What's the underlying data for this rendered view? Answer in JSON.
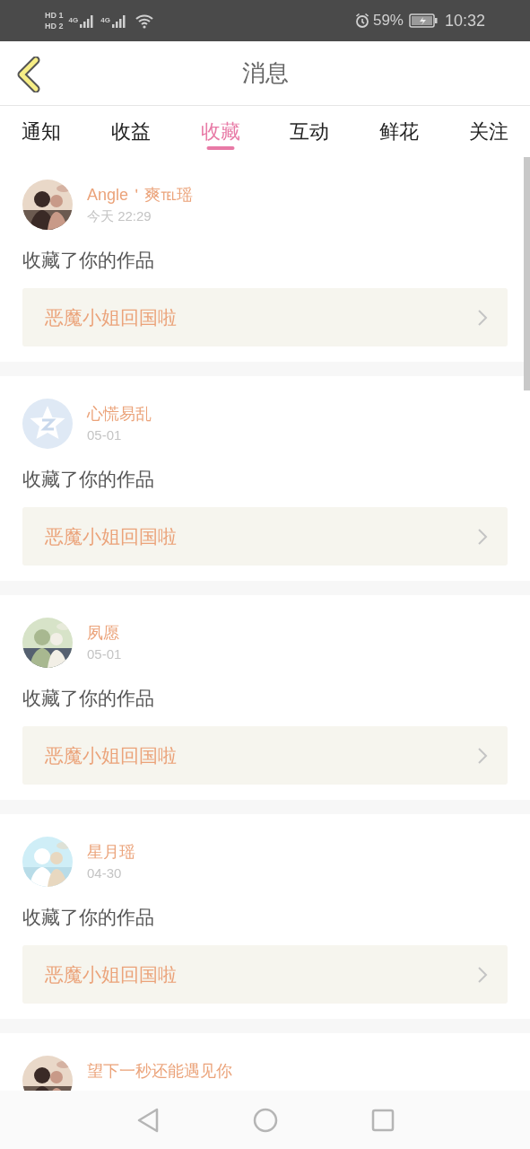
{
  "status_bar": {
    "sims": [
      {
        "hd": "HD",
        "slot": "1",
        "network": "4G"
      },
      {
        "hd": "HD",
        "slot": "2",
        "network": "4G"
      }
    ],
    "battery": "59%",
    "time": "10:32"
  },
  "header": {
    "title": "消息"
  },
  "tabs": [
    {
      "label": "通知",
      "selected": false
    },
    {
      "label": "收益",
      "selected": false
    },
    {
      "label": "收藏",
      "selected": true
    },
    {
      "label": "互动",
      "selected": false
    },
    {
      "label": "鲜花",
      "selected": false
    },
    {
      "label": "关注",
      "selected": false
    }
  ],
  "messages": [
    {
      "name": "Angle＇爽℡瑶",
      "time": "今天 22:29",
      "text": "收藏了你的作品",
      "work": "恶魔小姐回国啦"
    },
    {
      "avatar": {
        "kind": "default"
      },
      "name": "心慌易乱",
      "time": "05-01",
      "text": "收藏了你的作品",
      "work": "恶魔小姐回国啦"
    },
    {
      "name": "夙愿",
      "time": "05-01",
      "text": "收藏了你的作品",
      "work": "恶魔小姐回国啦"
    },
    {
      "name": "星月瑶",
      "time": "04-30",
      "text": "收藏了你的作品",
      "work": "恶魔小姐回国啦"
    },
    {
      "name": "望下一秒还能遇见你"
    }
  ]
}
